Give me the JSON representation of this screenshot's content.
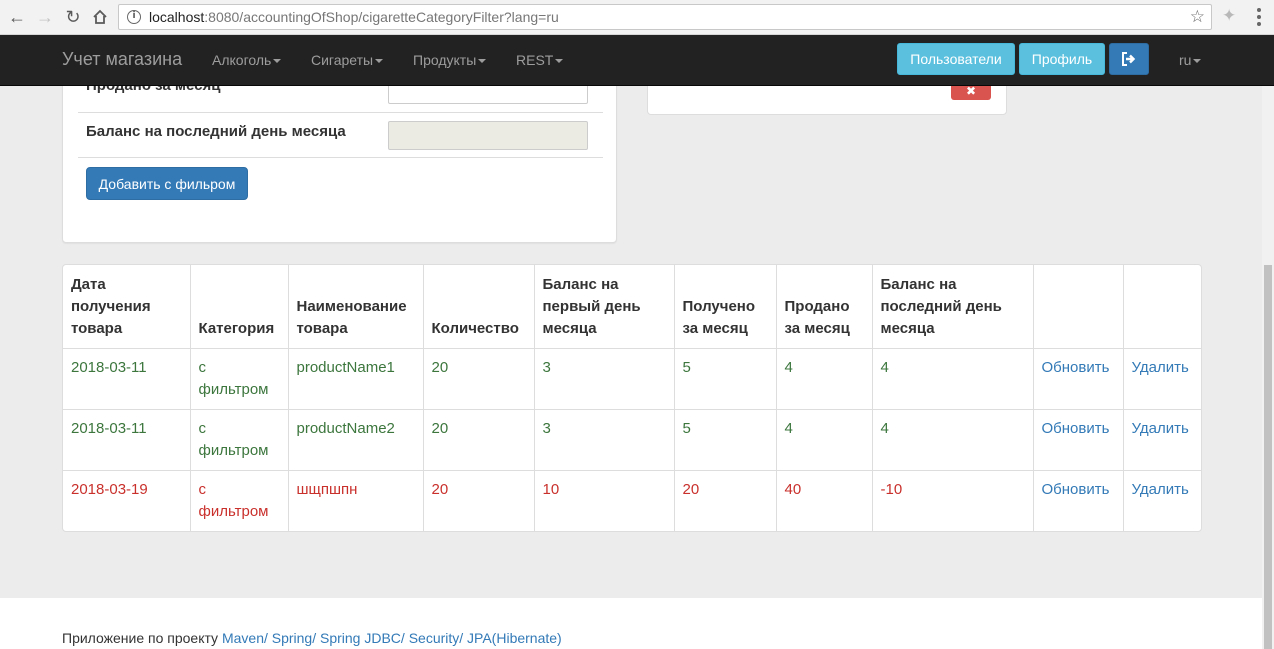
{
  "browser": {
    "url_host": "localhost",
    "url_rest": ":8080/accountingOfShop/cigaretteCategoryFilter?lang=ru"
  },
  "navbar": {
    "brand": "Учет магазина",
    "menu": [
      "Алкоголь",
      "Сигареты",
      "Продукты",
      "REST"
    ],
    "users_btn": "Пользователи",
    "profile_btn": "Профиль",
    "lang": "ru"
  },
  "form": {
    "sold_label": "Продано за месяц",
    "balance_last_label": "Баланс на последний день месяца",
    "add_btn": "Добавить с фильром"
  },
  "table": {
    "headers": [
      "Дата получения товара",
      "Категория",
      "Наименование товара",
      "Количество",
      "Баланс на первый день месяца",
      "Получено за месяц",
      "Продано за месяц",
      "Баланс на последний день месяца",
      "",
      ""
    ],
    "rows": [
      {
        "status": "ok",
        "date": "2018-03-11",
        "category": "с фильтром",
        "name": "productName1",
        "qty": "20",
        "bal_first": "3",
        "received": "5",
        "sold": "4",
        "bal_last": "4",
        "update": "Обновить",
        "delete": "Удалить"
      },
      {
        "status": "ok",
        "date": "2018-03-11",
        "category": "с фильтром",
        "name": "productName2",
        "qty": "20",
        "bal_first": "3",
        "received": "5",
        "sold": "4",
        "bal_last": "4",
        "update": "Обновить",
        "delete": "Удалить"
      },
      {
        "status": "bad",
        "date": "2018-03-19",
        "category": "с фильтром",
        "name": "шщпшпн",
        "qty": "20",
        "bal_first": "10",
        "received": "20",
        "sold": "40",
        "bal_last": "-10",
        "update": "Обновить",
        "delete": "Удалить"
      }
    ]
  },
  "footer": {
    "prefix": "Приложение по проекту ",
    "links": "Maven/ Spring/ Spring JDBC/ Security/ JPA(Hibernate)"
  },
  "colors": {
    "ok": "#3c763d",
    "bad": "#c9302c",
    "link": "#337ab7",
    "navbar": "#222222",
    "info_btn": "#5bc0de",
    "primary_btn": "#337ab7",
    "danger_btn": "#d9534f"
  }
}
